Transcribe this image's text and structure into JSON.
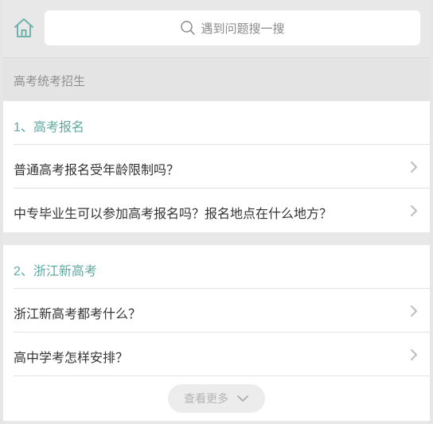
{
  "header": {
    "home_icon": "home-icon",
    "search_icon": "search-icon",
    "search_placeholder": "遇到问题搜一搜"
  },
  "section": {
    "label": "高考统考招生"
  },
  "groups": [
    {
      "heading": "1、高考报名",
      "items": [
        "普通高考报名受年龄限制吗？",
        "中专毕业生可以参加高考报名吗？报名地点在什么地方？"
      ]
    },
    {
      "heading": "2、浙江新高考",
      "items": [
        "浙江新高考都考什么？",
        "高中学考怎样安排？"
      ]
    }
  ],
  "more_button": {
    "label": "查看更多",
    "icon": "chevron-down-icon"
  },
  "colors": {
    "accent": "#5fa9a1",
    "text": "#333333",
    "muted": "#8f8f8f",
    "background": "#e8e8e8"
  }
}
